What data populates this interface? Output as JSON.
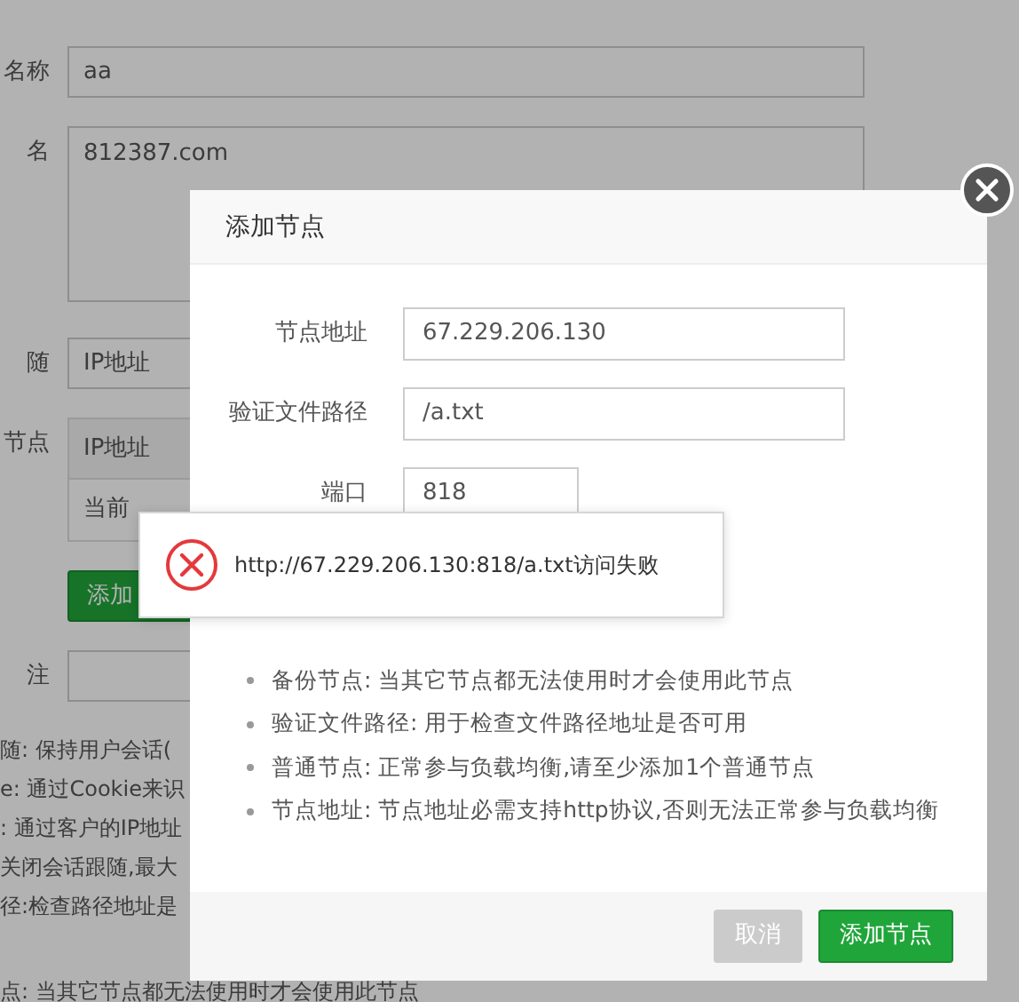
{
  "background_form": {
    "fields": [
      {
        "label": "名称",
        "kind": "input",
        "value": "aa"
      },
      {
        "label": "名",
        "kind": "textarea",
        "value": "812387.com"
      },
      {
        "label": "随",
        "kind": "select",
        "value": "IP地址"
      },
      {
        "label": "节点",
        "kind": "table",
        "header": "IP地址",
        "cell": "当前"
      },
      {
        "kind": "button",
        "value": "添加"
      },
      {
        "label": "注",
        "kind": "input"
      }
    ],
    "help_lines": [
      "随: 保持用户会话(",
      "e: 通过Cookie来识",
      ": 通过客户的IP地址",
      "关闭会话跟随,最大",
      "径:检查路径地址是"
    ],
    "bottom_line": "点: 当其它节点都无法使用时才会使用此节点"
  },
  "dialog": {
    "title": "添加节点",
    "fields": [
      {
        "label": "节点地址",
        "value": "67.229.206.130"
      },
      {
        "label": "验证文件路径",
        "value": "/a.txt"
      },
      {
        "label": "端口",
        "value": "818"
      }
    ],
    "notes": [
      "备份节点: 当其它节点都无法使用时才会使用此节点",
      "验证文件路径: 用于检查文件路径地址是否可用",
      "普通节点: 正常参与负载均衡,请至少添加1个普通节点",
      "节点地址: 节点地址必需支持http协议,否则无法正常参与负载均衡"
    ],
    "buttons": [
      {
        "label": "取消",
        "disabled": true
      },
      {
        "label": "添加节点",
        "disabled": false
      }
    ]
  },
  "toast": {
    "message": "http://67.229.206.130:818/a.txt访问失败"
  }
}
